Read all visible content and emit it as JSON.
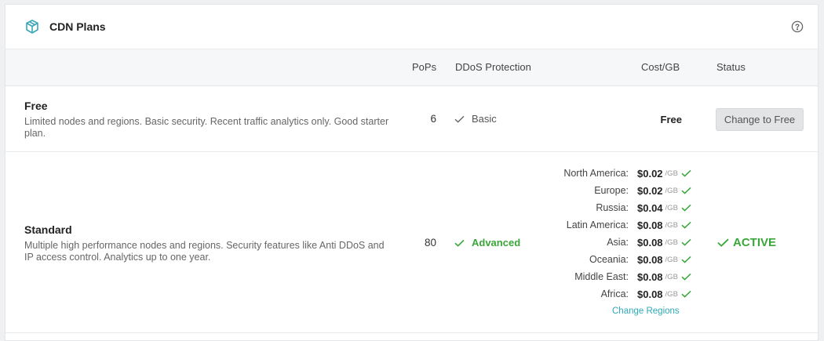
{
  "header": {
    "title": "CDN Plans",
    "icon": "cube-icon",
    "help_icon": "help-circle-icon",
    "accent_color": "#3aa6b8"
  },
  "columns": {
    "pops": "PoPs",
    "ddos": "DDoS Protection",
    "cost": "Cost/GB",
    "status": "Status"
  },
  "plans": [
    {
      "name": "Free",
      "description": "Limited nodes and regions. Basic security. Recent traffic analytics only. Good starter plan.",
      "pops": "6",
      "ddos": "Basic",
      "cost": "Free",
      "action_label": "Change to Free"
    },
    {
      "name": "Standard",
      "description": "Multiple high performance nodes and regions. Security features like Anti DDoS and IP access control. Analytics up to one year.",
      "pops": "80",
      "ddos": "Advanced",
      "status": "ACTIVE",
      "status_color": "#3aa63a",
      "regions": [
        {
          "name": "North America:",
          "price": "$0.02",
          "unit": "/GB"
        },
        {
          "name": "Europe:",
          "price": "$0.02",
          "unit": "/GB"
        },
        {
          "name": "Russia:",
          "price": "$0.04",
          "unit": "/GB"
        },
        {
          "name": "Latin America:",
          "price": "$0.08",
          "unit": "/GB"
        },
        {
          "name": "Asia:",
          "price": "$0.08",
          "unit": "/GB"
        },
        {
          "name": "Oceania:",
          "price": "$0.08",
          "unit": "/GB"
        },
        {
          "name": "Middle East:",
          "price": "$0.08",
          "unit": "/GB"
        },
        {
          "name": "Africa:",
          "price": "$0.08",
          "unit": "/GB"
        }
      ],
      "change_regions_label": "Change Regions"
    }
  ]
}
